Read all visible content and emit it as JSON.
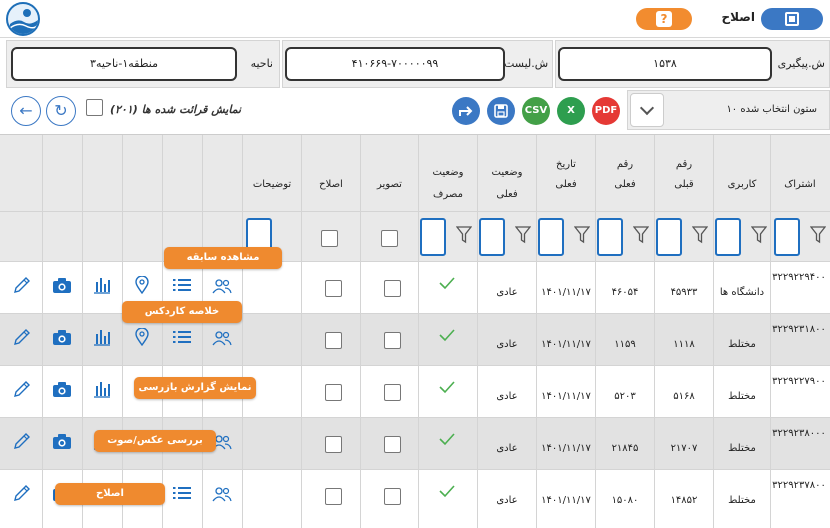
{
  "header": {
    "title": "اصلاح",
    "help_label": "?"
  },
  "filters": {
    "tracking_label": "ش.پیگیری",
    "tracking_value": "۱۵۳۸",
    "list_label": "ش.لیست",
    "list_value": "۴۱۰۶۶۹-۷۰۰۰۰۰۹۹",
    "area_label": "ناحیه",
    "area_value": "منطقه۱-ناحیه۳"
  },
  "toolbar": {
    "column_select_text": "۱۰ ستون انتخاب شده",
    "read_count_text": "(۲۰۱) نمایش قرائت شده ها",
    "export_buttons": [
      "pdf",
      "excel",
      "csv",
      "save",
      "forward"
    ]
  },
  "table": {
    "columns": {
      "account": "اشتراک",
      "usage": "کاربری",
      "prev_number_1": "رقم",
      "prev_number_2": "قبلی",
      "curr_number_1": "رقم",
      "curr_number_2": "فعلی",
      "date_1": "تاریخ",
      "date_2": "فعلی",
      "status_1": "وضعیت",
      "status_2": "فعلی",
      "cons_status_1": "وضعیت",
      "cons_status_2": "مصرف",
      "image": "تصویر",
      "correction": "اصلاح",
      "notes": "توضیحات"
    },
    "rows": [
      {
        "account": "۳۲۲۹۲۲۹۴۰۰",
        "usage": "دانشگاه ها",
        "prev": "۴۵۹۳۳",
        "curr": "۴۶۰۵۴",
        "date": "۱۴۰۱/۱۱/۱۷",
        "status": "عادی",
        "ok": true
      },
      {
        "account": "۳۲۲۹۲۳۱۸۰۰",
        "usage": "مختلط",
        "prev": "۱۱۱۸",
        "curr": "۱۱۵۹",
        "date": "۱۴۰۱/۱۱/۱۷",
        "status": "عادی",
        "ok": true
      },
      {
        "account": "۳۲۲۹۲۲۷۹۰۰",
        "usage": "مختلط",
        "prev": "۵۱۶۸",
        "curr": "۵۲۰۳",
        "date": "۱۴۰۱/۱۱/۱۷",
        "status": "عادی",
        "ok": true
      },
      {
        "account": "۳۲۲۹۲۳۸۰۰۰",
        "usage": "مختلط",
        "prev": "۲۱۷۰۷",
        "curr": "۲۱۸۴۵",
        "date": "۱۴۰۱/۱۱/۱۷",
        "status": "عادی",
        "ok": true
      },
      {
        "account": "۳۲۲۹۲۳۷۸۰۰",
        "usage": "مختلط",
        "prev": "۱۴۸۵۲",
        "curr": "۱۵۰۸۰",
        "date": "۱۴۰۱/۱۱/۱۷",
        "status": "عادی",
        "ok": true
      }
    ]
  },
  "tooltips": {
    "history": "مشاهده سابقه",
    "cardex": "خلاصه کاردکس",
    "inspection_report": "نمایش گزارش بازرسی",
    "review_image": "بررسی عکس/صوت",
    "edit": "اصلاح"
  },
  "colors": {
    "accent_blue": "#3b78c4",
    "accent_orange": "#ef8a2f",
    "check_green": "#4caf50",
    "pdf_red": "#e53935",
    "excel_green": "#2e9e4f"
  }
}
